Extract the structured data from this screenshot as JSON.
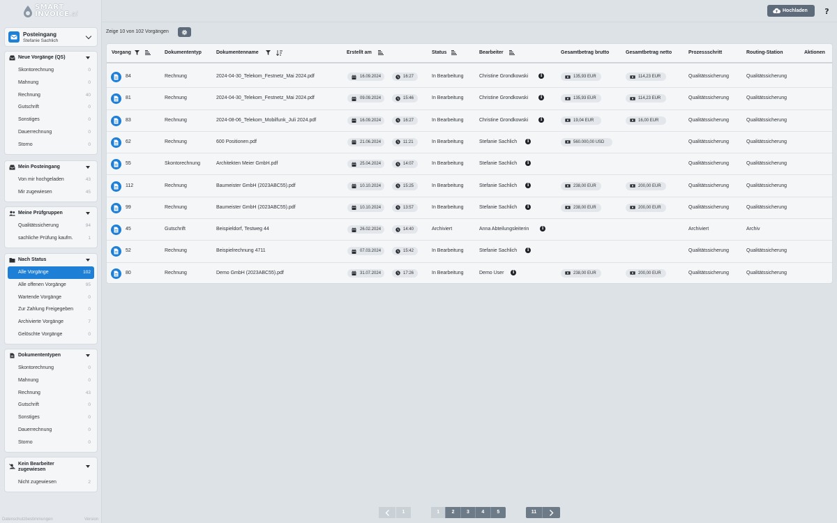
{
  "brand": {
    "line1": "SMART",
    "line2": "INVOICE",
    "suffix": ".ai"
  },
  "inbox": {
    "title": "Posteingang",
    "user": "Stefanie Sachlich"
  },
  "sidebar": {
    "panels": [
      {
        "title": "Neue Vorgänge (QS)",
        "icon": "inbox-tray-icon",
        "items": [
          {
            "label": "Skontorechnung",
            "count": "0"
          },
          {
            "label": "Mahnung",
            "count": "0"
          },
          {
            "label": "Rechnung",
            "count": "40"
          },
          {
            "label": "Gutschrift",
            "count": "0"
          },
          {
            "label": "Sonstiges",
            "count": "0"
          },
          {
            "label": "Dauerrechnung",
            "count": "0"
          },
          {
            "label": "Storno",
            "count": "0"
          }
        ]
      },
      {
        "title": "Mein Posteingang",
        "icon": "inbox-tray-icon",
        "items": [
          {
            "label": "Von mir hochgeladen",
            "count": "43"
          },
          {
            "label": "Mir zugewiesen",
            "count": "45"
          }
        ]
      },
      {
        "title": "Meine Prüfgruppen",
        "icon": "users-icon",
        "items": [
          {
            "label": "Qualitätssicherung",
            "count": "94"
          },
          {
            "label": "sachliche Prüfung kaufm.",
            "count": "1"
          }
        ]
      },
      {
        "title": "Nach Status",
        "icon": "folder-icon",
        "items": [
          {
            "label": "Alle Vorgänge",
            "count": "102"
          },
          {
            "label": "Alle offenen Vorgänge",
            "count": "95"
          },
          {
            "label": "Wartende Vorgänge",
            "count": "0"
          },
          {
            "label": "Zur Zahlung Freigegeben",
            "count": "0"
          },
          {
            "label": "Archivierte Vorgänge",
            "count": "7"
          },
          {
            "label": "Gelöschte Vorgänge",
            "count": "0"
          }
        ]
      },
      {
        "title": "Dokumententypen",
        "icon": "file-icon",
        "items": [
          {
            "label": "Skontorechnung",
            "count": "0"
          },
          {
            "label": "Mahnung",
            "count": "0"
          },
          {
            "label": "Rechnung",
            "count": "43"
          },
          {
            "label": "Gutschrift",
            "count": "0"
          },
          {
            "label": "Sonstiges",
            "count": "0"
          },
          {
            "label": "Dauerrechnung",
            "count": "0"
          },
          {
            "label": "Storno",
            "count": "0"
          }
        ]
      },
      {
        "title": "Kein Bearbeiter zugewiesen",
        "icon": "user-slash-icon",
        "items": [
          {
            "label": "Nicht zugewiesen",
            "count": "2"
          }
        ]
      }
    ]
  },
  "footer": {
    "privacy": "Datenschutzbestimmungen",
    "version": "Version"
  },
  "toolbar": {
    "upload_label": "Hochladen",
    "summary": "Zeige 10 von 102 Vorgängen"
  },
  "table": {
    "headers": {
      "vorgang": "Vorgang",
      "doctype": "Dokumententyp",
      "docname": "Dokumentenname",
      "created": "Erstellt am",
      "status": "Status",
      "editor": "Bearbeiter",
      "gross": "Gesamtbetrag brutto",
      "net": "Gesamtbetrag netto",
      "step": "Prozessschritt",
      "station": "Routing-Station",
      "actions": "Aktionen"
    },
    "rows": [
      {
        "id": "84",
        "type": "Rechnung",
        "name": "2024-04-30_Telekom_Festnetz_Mai 2024.pdf",
        "date": "16.09.2024",
        "time": "16:27",
        "status": "In Bearbeitung",
        "editor": "Christine Grondkowski",
        "gross": "135,93 EUR",
        "net": "114,23 EUR",
        "step": "Qualitätssicherung",
        "station": "Qualitätssicherung"
      },
      {
        "id": "81",
        "type": "Rechnung",
        "name": "2024-04-30_Telekom_Festnetz_Mai 2024.pdf",
        "date": "09.09.2024",
        "time": "15:46",
        "status": "In Bearbeitung",
        "editor": "Christine Grondkowski",
        "gross": "135,93 EUR",
        "net": "114,23 EUR",
        "step": "Qualitätssicherung",
        "station": "Qualitätssicherung"
      },
      {
        "id": "83",
        "type": "Rechnung",
        "name": "2024-08-06_Telekom_Mobilfunk_Juli 2024.pdf",
        "date": "16.09.2024",
        "time": "16:27",
        "status": "In Bearbeitung",
        "editor": "Christine Grondkowski",
        "gross": "19,04 EUR",
        "net": "16,00 EUR",
        "step": "Qualitätssicherung",
        "station": "Qualitätssicherung"
      },
      {
        "id": "62",
        "type": "Rechnung",
        "name": "600 Positionen.pdf",
        "date": "21.06.2024",
        "time": "11:21",
        "status": "In Bearbeitung",
        "editor": "Stefanie Sachlich",
        "gross": "560.000,00 USD",
        "net": "",
        "step": "Qualitätssicherung",
        "station": "Qualitätssicherung"
      },
      {
        "id": "55",
        "type": "Skontorechnung",
        "name": "Architekten Meier GmbH.pdf",
        "date": "25.04.2024",
        "time": "14:07",
        "status": "In Bearbeitung",
        "editor": "Stefanie Sachlich",
        "gross": "",
        "net": "",
        "step": "Qualitätssicherung",
        "station": "Qualitätssicherung"
      },
      {
        "id": "112",
        "type": "Rechnung",
        "name": "Baumeister GmbH (2023ABC55).pdf",
        "date": "10.10.2024",
        "time": "15:25",
        "status": "In Bearbeitung",
        "editor": "Stefanie Sachlich",
        "gross": "238,00 EUR",
        "net": "200,00 EUR",
        "step": "Qualitätssicherung",
        "station": "Qualitätssicherung"
      },
      {
        "id": "99",
        "type": "Rechnung",
        "name": "Baumeister GmbH (2023ABC55).pdf",
        "date": "10.10.2024",
        "time": "13:57",
        "status": "In Bearbeitung",
        "editor": "Stefanie Sachlich",
        "gross": "238,00 EUR",
        "net": "200,00 EUR",
        "step": "Qualitätssicherung",
        "station": "Qualitätssicherung"
      },
      {
        "id": "45",
        "type": "Gutschrift",
        "name": "Beispieldorf, Testweg 44",
        "date": "26.02.2024",
        "time": "14:40",
        "status": "Archiviert",
        "editor": "Anna Abteilungsleiterin",
        "gross": "",
        "net": "",
        "step": "Archiviert",
        "station": "Archiv"
      },
      {
        "id": "52",
        "type": "Rechnung",
        "name": "Beispielrechnung 4711",
        "date": "07.03.2024",
        "time": "15:42",
        "status": "In Bearbeitung",
        "editor": "Stefanie Sachlich",
        "gross": "",
        "net": "",
        "step": "Qualitätssicherung",
        "station": "Qualitätssicherung"
      },
      {
        "id": "80",
        "type": "Rechnung",
        "name": "Demo GmbH (2023ABC55).pdf",
        "date": "31.07.2024",
        "time": "17:26",
        "status": "In Bearbeitung",
        "editor": "Demo User",
        "gross": "238,00 EUR",
        "net": "200,00 EUR",
        "step": "Qualitätssicherung",
        "station": "Qualitätssicherung"
      }
    ]
  },
  "pagination": {
    "pages": [
      "1",
      "2",
      "3",
      "4",
      "5"
    ],
    "last": "11",
    "current": "1"
  },
  "colors": {
    "accent": "#1e7fd6",
    "button": "#5d6b7a",
    "background": "#dde2e7"
  }
}
